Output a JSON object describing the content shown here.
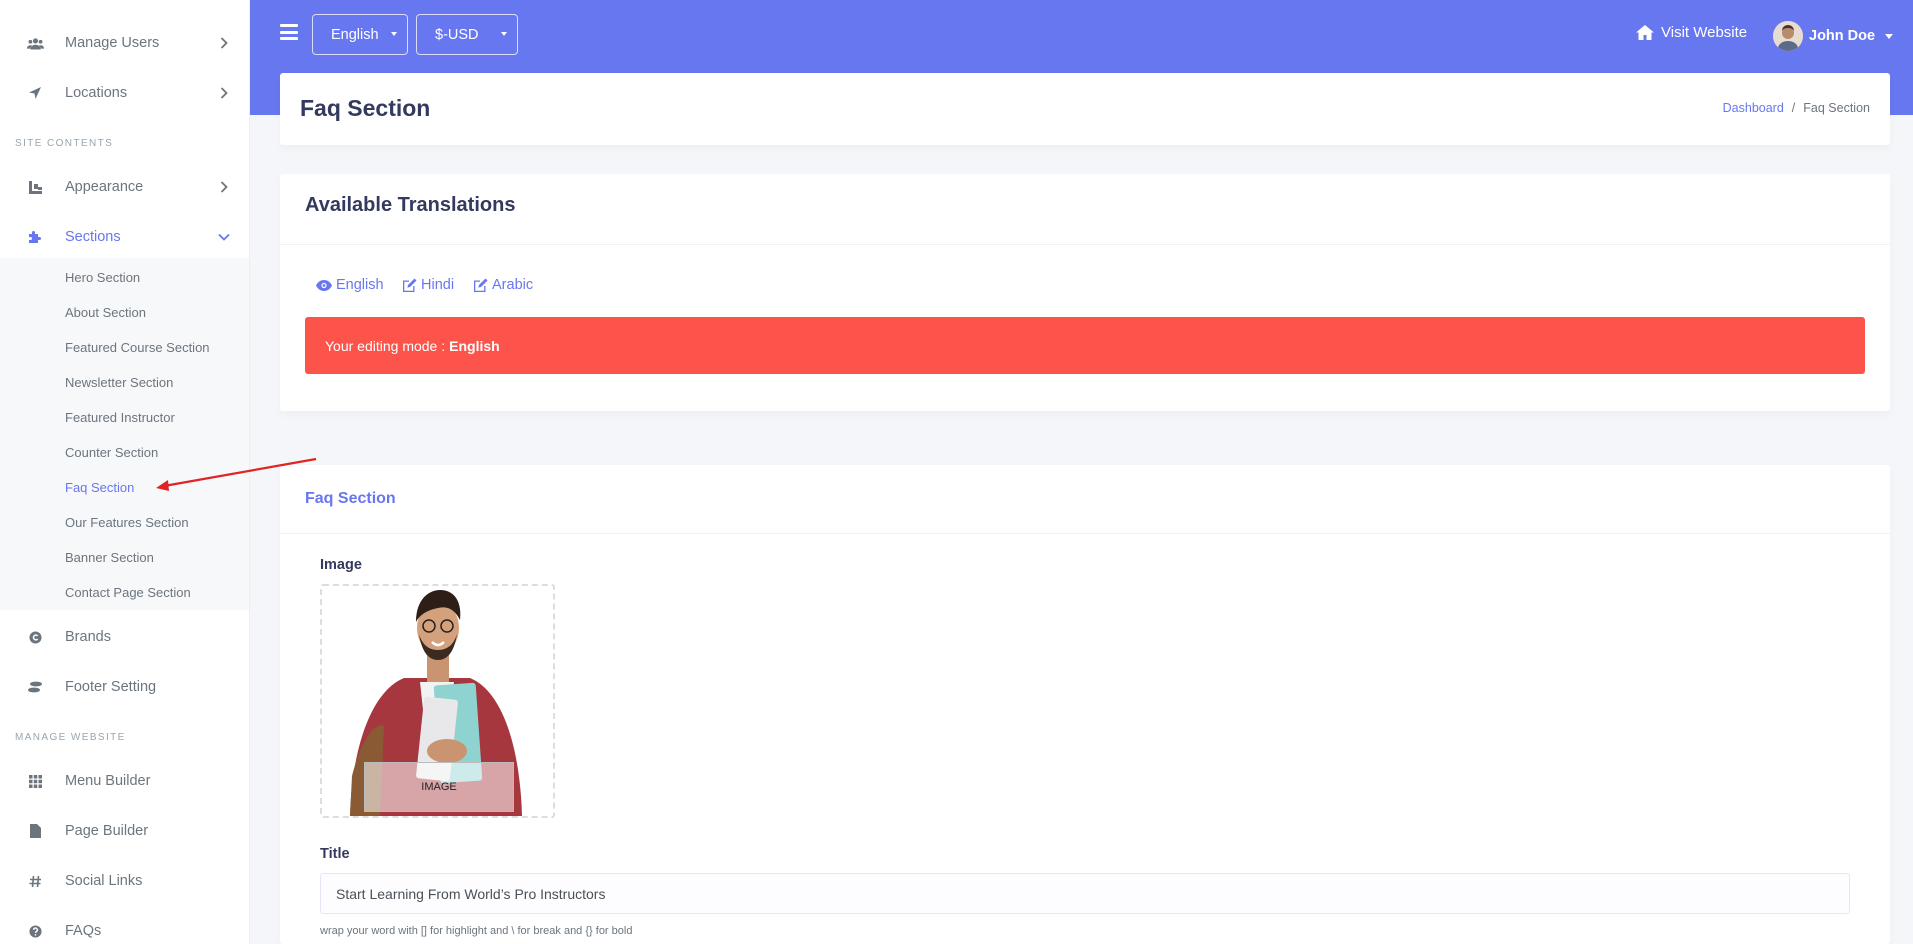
{
  "sidebar": {
    "items_top": [
      {
        "label": "Manage Users",
        "icon": "users-icon"
      },
      {
        "label": "Locations",
        "icon": "location-arrow-icon"
      }
    ],
    "header_site": "SITE CONTENTS",
    "appearance": "Appearance",
    "sections": "Sections",
    "sub_items": [
      "Hero Section",
      "About Section",
      "Featured Course Section",
      "Newsletter Section",
      "Featured Instructor",
      "Counter Section",
      "Faq Section",
      "Our Features Section",
      "Banner Section",
      "Contact Page Section"
    ],
    "brands": "Brands",
    "footer": "Footer Setting",
    "header_manage": "MANAGE WEBSITE",
    "menu_builder": "Menu Builder",
    "page_builder": "Page Builder",
    "social_links": "Social Links",
    "faqs": "FAQs"
  },
  "topbar": {
    "language": "English",
    "currency": "$-USD",
    "visit_website": "Visit Website",
    "user_name": "John Doe"
  },
  "page": {
    "title": "Faq Section",
    "breadcrumb_home": "Dashboard",
    "breadcrumb_sep": "/",
    "breadcrumb_current": "Faq Section"
  },
  "translations": {
    "heading": "Available Translations",
    "languages": [
      "English",
      "Hindi",
      "Arabic"
    ],
    "editing_prefix": "Your editing mode :",
    "editing_lang": "English"
  },
  "form": {
    "heading": "Faq Section",
    "image_label": "Image",
    "image_caption": "IMAGE",
    "title_label": "Title",
    "title_value": "Start Learning From World’s Pro Instructors",
    "help_text": "wrap your word with [] for highlight and \\ for break and {} for bold"
  },
  "colors": {
    "primary": "#6777ef",
    "danger": "#fc544b",
    "sidebar_text": "#6c757d"
  }
}
